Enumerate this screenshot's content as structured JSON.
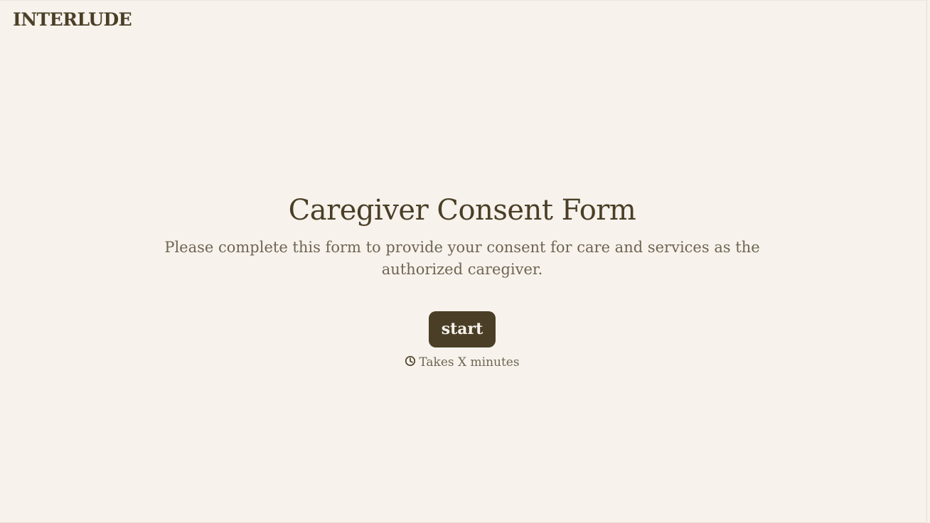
{
  "header": {
    "logo_text": "INTERLUDE"
  },
  "intro": {
    "title": "Caregiver Consent Form",
    "description": "Please complete this form to provide your consent for care and services as the authorized caregiver.",
    "start_label": "start",
    "duration_icon": "clock-icon",
    "duration_text": "Takes X minutes"
  },
  "colors": {
    "background": "#f7f2ec",
    "primary_text": "#4a3f26",
    "secondary_text": "#6e6552",
    "button_background": "#4a3f26",
    "button_text": "#f7f2ec"
  }
}
